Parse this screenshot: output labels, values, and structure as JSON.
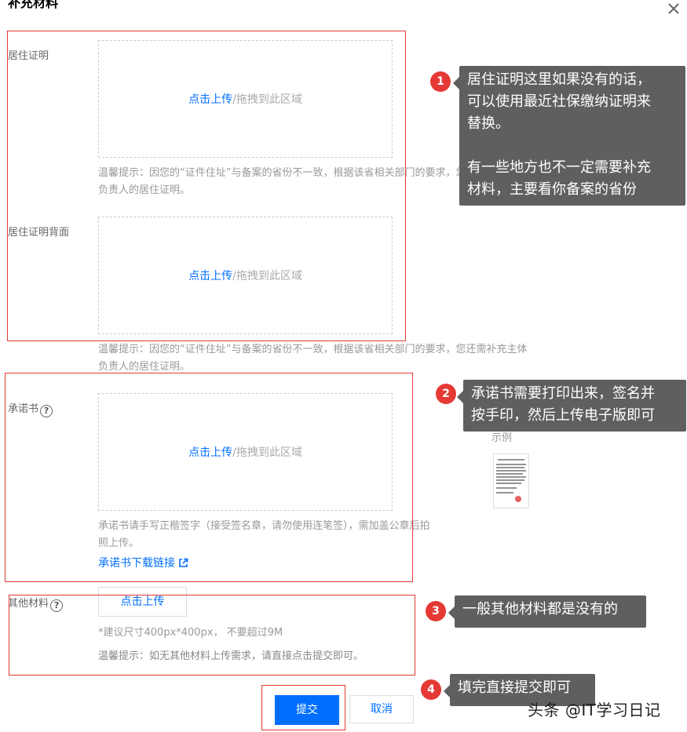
{
  "dialog": {
    "title": "补充材料",
    "close_icon": "close-icon"
  },
  "residence": {
    "label": "居住证明",
    "upload_link": "点击上传",
    "upload_rest": "/拖拽到此区域",
    "hint_line1": "温馨提示：因您的“证件住址”与备案的省份不一致，根据该省相关部门的要求，您还需补充主体",
    "hint_line2": "负责人的居住证明。"
  },
  "residence_back": {
    "label": "居住证明背面",
    "upload_link": "点击上传",
    "upload_rest": "/拖拽到此区域",
    "hint_line1": "温馨提示：因您的“证件住址”与备案的省份不一致，根据该省相关部门的要求，您还需补充主体",
    "hint_line2": "负责人的居住证明。"
  },
  "commitment": {
    "label": "承诺书",
    "upload_link": "点击上传",
    "upload_rest": "/拖拽到此区域",
    "example_label": "示例",
    "hint_line1": "承诺书请手写正楷签字（接受签名章，请勿使用连笔签），需加盖公章后拍",
    "hint_line2": "照上传。",
    "download_link": "承诺书下载链接"
  },
  "other": {
    "label": "其他材料",
    "upload_button": "点击上传",
    "size_hint": "*建议尺寸400px*400px， 不要超过9M",
    "hint": "温馨提示：如无其他材料上传需求，请直接点击提交即可。"
  },
  "actions": {
    "submit": "提交",
    "cancel": "取消"
  },
  "annotations": {
    "callout1": {
      "badge": "1",
      "line1": "居住证明这里如果没有的话，",
      "line2": "可以使用最近社保缴纳证明来",
      "line3": "替换。",
      "line4": "有一些地方也不一定需要补充",
      "line5": "材料，主要看你备案的省份"
    },
    "callout2": {
      "badge": "2",
      "line1": "承诺书需要打印出来，签名并",
      "line2": "按手印，然后上传电子版即可"
    },
    "callout3": {
      "badge": "3",
      "text": "一般其他材料都是没有的"
    },
    "callout4": {
      "badge": "4",
      "text": "填完直接提交即可"
    }
  },
  "watermark": "头条 @IT学习日记",
  "colors": {
    "link_blue": "#006eff",
    "annotation_red": "#e53935",
    "callout_grey": "#5f5f5f"
  }
}
